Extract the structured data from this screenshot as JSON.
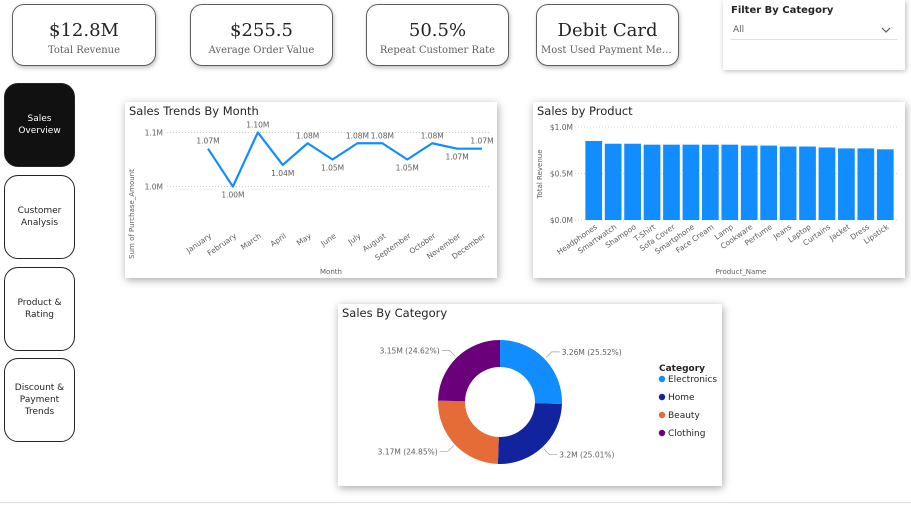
{
  "kpis": [
    {
      "value": "$12.8M",
      "label": "Total Revenue"
    },
    {
      "value": "$255.5",
      "label": "Average Order Value"
    },
    {
      "value": "50.5%",
      "label": "Repeat Customer Rate"
    },
    {
      "value": "Debit Card",
      "label": "Most Used Payment Met..."
    }
  ],
  "filter": {
    "title": "Filter By Category",
    "selected": "All"
  },
  "nav": [
    {
      "label": "Sales Overview",
      "active": true
    },
    {
      "label": "Customer Analysis",
      "active": false
    },
    {
      "label": "Product & Rating",
      "active": false
    },
    {
      "label": "Discount & Payment Trends",
      "active": false
    }
  ],
  "charts": {
    "trend_title": "Sales Trends By Month",
    "trend_xlabel": "Month",
    "trend_ylabel": "Sum of Purchase_Amount",
    "product_title": "Sales by Product",
    "product_xlabel": "Product_Name",
    "product_ylabel": "Total Revenue",
    "category_title": "Sales By Category",
    "legend_title": "Category"
  },
  "chart_data": [
    {
      "type": "line",
      "title": "Sales Trends By Month",
      "xlabel": "Month",
      "ylabel": "Sum of Purchase_Amount",
      "categories": [
        "January",
        "February",
        "March",
        "April",
        "May",
        "June",
        "July",
        "August",
        "September",
        "October",
        "November",
        "December"
      ],
      "values": [
        1.07,
        1.0,
        1.1,
        1.04,
        1.08,
        1.05,
        1.08,
        1.08,
        1.05,
        1.08,
        1.07,
        1.07
      ],
      "data_labels": [
        "1.07M",
        "1.00M",
        "1.10M",
        "1.04M",
        "1.08M",
        "1.05M",
        "1.08M",
        "1.08M",
        "1.05M",
        "1.08M",
        "1.07M",
        "1.07M"
      ],
      "y_ticks": [
        "1.1M",
        "1.0M"
      ],
      "ylim": [
        0.99,
        1.11
      ],
      "color": "#118dff"
    },
    {
      "type": "bar",
      "title": "Sales by Product",
      "xlabel": "Product_Name",
      "ylabel": "Total Revenue",
      "categories": [
        "Headphones",
        "Smartwatch",
        "Shampoo",
        "T-Shirt",
        "Sofa Cover",
        "Smartphone",
        "Face Cream",
        "Lamp",
        "Cookware",
        "Perfume",
        "Jeans",
        "Laptop",
        "Curtains",
        "Jacket",
        "Dress",
        "Lipstick"
      ],
      "values": [
        0.85,
        0.82,
        0.82,
        0.81,
        0.81,
        0.81,
        0.81,
        0.81,
        0.8,
        0.8,
        0.79,
        0.79,
        0.78,
        0.77,
        0.77,
        0.76
      ],
      "y_ticks": [
        "$1.0M",
        "$0.5M",
        "$0.0M"
      ],
      "ylim": [
        0,
        1.0
      ],
      "color": "#118dff"
    },
    {
      "type": "pie",
      "title": "Sales By Category",
      "legend_title": "Category",
      "legend_position": "right",
      "series": [
        {
          "name": "Electronics",
          "value": 3.26,
          "label": "3.26M (25.52%)",
          "color": "#118dff"
        },
        {
          "name": "Home",
          "value": 3.2,
          "label": "3.2M (25.01%)",
          "color": "#12239e"
        },
        {
          "name": "Beauty",
          "value": 3.17,
          "label": "3.17M (24.85%)",
          "color": "#e66c37"
        },
        {
          "name": "Clothing",
          "value": 3.15,
          "label": "3.15M (24.62%)",
          "color": "#6b007b"
        }
      ]
    }
  ]
}
